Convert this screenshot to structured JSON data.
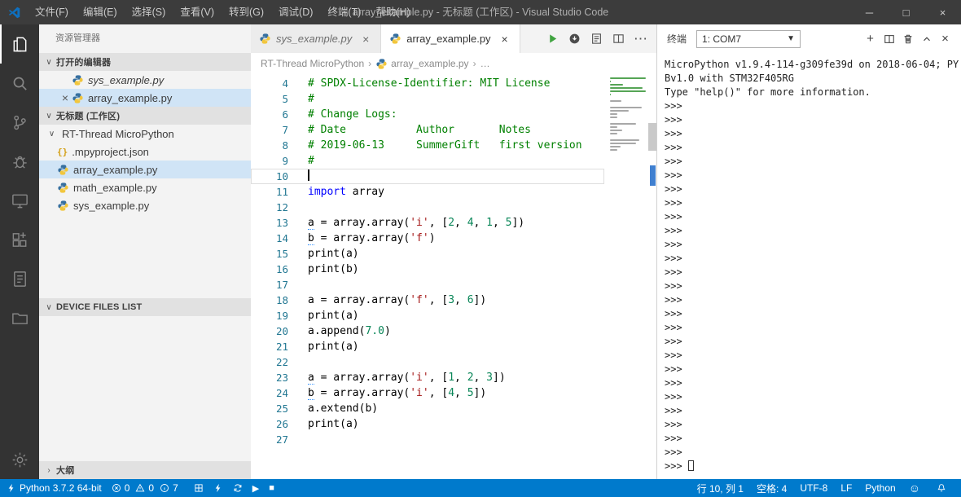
{
  "titlebar": {
    "menus": [
      "文件(F)",
      "编辑(E)",
      "选择(S)",
      "查看(V)",
      "转到(G)",
      "调试(D)",
      "终端(T)",
      "帮助(H)"
    ],
    "title": "array_example.py - 无标题 (工作区) - Visual Studio Code",
    "window_controls": [
      "minimize",
      "maximize",
      "close"
    ]
  },
  "activitybar": {
    "top": [
      {
        "icon": "files",
        "active": true
      },
      {
        "icon": "search"
      },
      {
        "icon": "source-control"
      },
      {
        "icon": "debug"
      },
      {
        "icon": "device"
      },
      {
        "icon": "extensions"
      },
      {
        "icon": "report"
      },
      {
        "icon": "project"
      }
    ],
    "bottom": [
      {
        "icon": "gear"
      }
    ]
  },
  "sidebar": {
    "title": "资源管理器",
    "open_editors": {
      "label": "打开的编辑器",
      "items": [
        {
          "label": "sys_example.py",
          "icon": "python",
          "italic": true,
          "close": false,
          "selected": false
        },
        {
          "label": "array_example.py",
          "icon": "python",
          "italic": false,
          "close": true,
          "selected": true
        }
      ]
    },
    "workspace": {
      "label": "无标题 (工作区)",
      "tree": [
        {
          "label": "RT-Thread MicroPython",
          "type": "folder",
          "level": 0,
          "selected": false
        },
        {
          "label": ".mpyproject.json",
          "type": "json",
          "level": 1,
          "selected": false
        },
        {
          "label": "array_example.py",
          "type": "python",
          "level": 1,
          "selected": true
        },
        {
          "label": "math_example.py",
          "type": "python",
          "level": 1,
          "selected": false
        },
        {
          "label": "sys_example.py",
          "type": "python",
          "level": 1,
          "selected": false
        }
      ]
    },
    "device_files": {
      "label": "DEVICE FILES LIST",
      "chevron": "∨"
    },
    "outline": {
      "label": "大纲",
      "chevron": "›"
    }
  },
  "editor_tabs": [
    {
      "label": "sys_example.py",
      "icon": "python",
      "italic": true,
      "active": false
    },
    {
      "label": "array_example.py",
      "icon": "python",
      "italic": false,
      "active": true
    }
  ],
  "editor_actions": [
    {
      "icon": "run"
    },
    {
      "icon": "download"
    },
    {
      "icon": "preview"
    },
    {
      "icon": "split-editor"
    },
    {
      "icon": "more"
    }
  ],
  "breadcrumbs": [
    {
      "label": "RT-Thread MicroPython"
    },
    {
      "label": "array_example.py",
      "icon": "python"
    },
    {
      "label": "…"
    }
  ],
  "editor": {
    "cursor_line": 10,
    "lines": [
      {
        "n": 4,
        "t": [
          [
            "# SPDX-License-Identifier: MIT License",
            "c"
          ]
        ]
      },
      {
        "n": 5,
        "t": [
          [
            "#",
            "c"
          ]
        ]
      },
      {
        "n": 6,
        "t": [
          [
            "# Change Logs:",
            "c"
          ]
        ]
      },
      {
        "n": 7,
        "t": [
          [
            "# Date           Author       Notes",
            "c"
          ]
        ]
      },
      {
        "n": 8,
        "t": [
          [
            "# 2019-06-13     SummerGift   first version",
            "c"
          ]
        ]
      },
      {
        "n": 9,
        "t": [
          [
            "#",
            "c"
          ]
        ]
      },
      {
        "n": 10,
        "t": []
      },
      {
        "n": 11,
        "t": [
          [
            "import",
            "k"
          ],
          [
            " array",
            "d"
          ]
        ]
      },
      {
        "n": 12,
        "t": []
      },
      {
        "n": 13,
        "t": [
          [
            "a",
            "v"
          ],
          [
            " = array.array(",
            "d"
          ],
          [
            "'i'",
            "s"
          ],
          [
            ", [",
            "d"
          ],
          [
            "2",
            "n"
          ],
          [
            ", ",
            "d"
          ],
          [
            "4",
            "n"
          ],
          [
            ", ",
            "d"
          ],
          [
            "1",
            "n"
          ],
          [
            ", ",
            "d"
          ],
          [
            "5",
            "n"
          ],
          [
            "])",
            "d"
          ]
        ]
      },
      {
        "n": 14,
        "t": [
          [
            "b",
            "v"
          ],
          [
            " = array.array(",
            "d"
          ],
          [
            "'f'",
            "s"
          ],
          [
            ")",
            "d"
          ]
        ]
      },
      {
        "n": 15,
        "t": [
          [
            "print(a)",
            "d"
          ]
        ]
      },
      {
        "n": 16,
        "t": [
          [
            "print(b)",
            "d"
          ]
        ]
      },
      {
        "n": 17,
        "t": []
      },
      {
        "n": 18,
        "t": [
          [
            "a = array.array(",
            "d"
          ],
          [
            "'f'",
            "s"
          ],
          [
            ", [",
            "d"
          ],
          [
            "3",
            "n"
          ],
          [
            ", ",
            "d"
          ],
          [
            "6",
            "n"
          ],
          [
            "])",
            "d"
          ]
        ]
      },
      {
        "n": 19,
        "t": [
          [
            "print(a)",
            "d"
          ]
        ]
      },
      {
        "n": 20,
        "t": [
          [
            "a.append(",
            "d"
          ],
          [
            "7.0",
            "n"
          ],
          [
            ")",
            "d"
          ]
        ]
      },
      {
        "n": 21,
        "t": [
          [
            "print(a)",
            "d"
          ]
        ]
      },
      {
        "n": 22,
        "t": []
      },
      {
        "n": 23,
        "t": [
          [
            "a",
            "v"
          ],
          [
            " = array.array(",
            "d"
          ],
          [
            "'i'",
            "s"
          ],
          [
            ", [",
            "d"
          ],
          [
            "1",
            "n"
          ],
          [
            ", ",
            "d"
          ],
          [
            "2",
            "n"
          ],
          [
            ", ",
            "d"
          ],
          [
            "3",
            "n"
          ],
          [
            "])",
            "d"
          ]
        ]
      },
      {
        "n": 24,
        "t": [
          [
            "b",
            "v"
          ],
          [
            " = array.array(",
            "d"
          ],
          [
            "'i'",
            "s"
          ],
          [
            ", [",
            "d"
          ],
          [
            "4",
            "n"
          ],
          [
            ", ",
            "d"
          ],
          [
            "5",
            "n"
          ],
          [
            "])",
            "d"
          ]
        ]
      },
      {
        "n": 25,
        "t": [
          [
            "a.extend(b)",
            "d"
          ]
        ]
      },
      {
        "n": 26,
        "t": [
          [
            "print(a)",
            "d"
          ]
        ]
      },
      {
        "n": 27,
        "t": []
      }
    ]
  },
  "terminal": {
    "title": "终端",
    "dropdown": "1: COM7",
    "actions": [
      "plus",
      "split",
      "trash",
      "chevron-up",
      "close"
    ],
    "output": [
      "MicroPython v1.9.4-114-g309fe39d on 2018-06-04; PY",
      "Bv1.0 with STM32F405RG",
      "Type \"help()\" for more information."
    ],
    "prompt": ">>>",
    "prompt_count": 26,
    "cursor_prompt": ">>> "
  },
  "statusbar": {
    "python_label": "Python 3.7.2 64-bit",
    "problems": {
      "errors": "0",
      "warnings": "0",
      "infos": "7"
    },
    "tools": [
      {
        "icon": "board"
      },
      {
        "icon": "zap"
      },
      {
        "icon": "sync"
      },
      {
        "icon": "play"
      },
      {
        "icon": "stop"
      }
    ],
    "right": [
      {
        "name": "cursor-position",
        "label": "行 10, 列 1"
      },
      {
        "name": "indentation",
        "label": "空格: 4"
      },
      {
        "name": "encoding",
        "label": "UTF-8"
      },
      {
        "name": "eol",
        "label": "LF"
      },
      {
        "name": "language-mode",
        "label": "Python"
      },
      {
        "name": "feedback",
        "icon": "smiley"
      },
      {
        "name": "notifications",
        "icon": "bell"
      }
    ]
  },
  "colors": {
    "statusbar": "#007acc",
    "comment": "#008000",
    "keyword": "#0000ff",
    "string": "#a31515",
    "number": "#098658",
    "selection": "#d0e4f6"
  }
}
